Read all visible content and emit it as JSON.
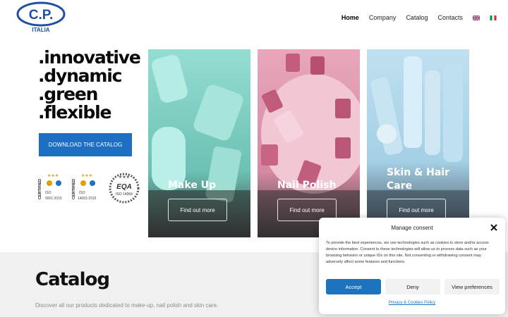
{
  "header": {
    "logo_text": "C.P.",
    "logo_sub": "ITALIA",
    "nav": [
      "Home",
      "Company",
      "Catalog",
      "Contacts"
    ],
    "languages": [
      "en-flag-icon",
      "it-flag-icon"
    ]
  },
  "hero": {
    "taglines": [
      ".innovative",
      ".dynamic",
      ".green",
      ".flexible"
    ],
    "download_label": "DOWNLOAD THE CATALOG",
    "certs": [
      {
        "label": "CERTIFIED",
        "iso": "ISO",
        "std": "9001:2015"
      },
      {
        "label": "CERTIFIED",
        "iso": "ISO",
        "std": "14001:2015"
      },
      {
        "label": "ISO 14064"
      }
    ]
  },
  "cards": [
    {
      "title": "Make Up",
      "button": "Find out more"
    },
    {
      "title": "Nail Polish",
      "button": "Find out more"
    },
    {
      "title": "Skin & Hair Care",
      "button": "Find out more"
    }
  ],
  "catalog": {
    "heading": "Catalog",
    "description": "Discover all our products dedicated to make-up, nail polish and skin care."
  },
  "consent": {
    "title": "Manage consent",
    "body": "To provide the best experiences, we use technologies such as cookies to store and/or access device information. Consent to these technologies will allow us to process data such as your browsing behavior or unique IDs on this site. Not consenting or withdrawing consent may adversely affect some features and functions.",
    "accept": "Accept",
    "deny": "Deny",
    "preferences": "View preferences",
    "link": "Privacy & Cookies Policy"
  },
  "colors": {
    "brand_blue": "#1d6fc4",
    "card_makeup": "#8fd3c8",
    "card_nail": "#e7a9bb",
    "card_skin": "#a9d3ea",
    "section_bg": "#f0f0f0"
  }
}
